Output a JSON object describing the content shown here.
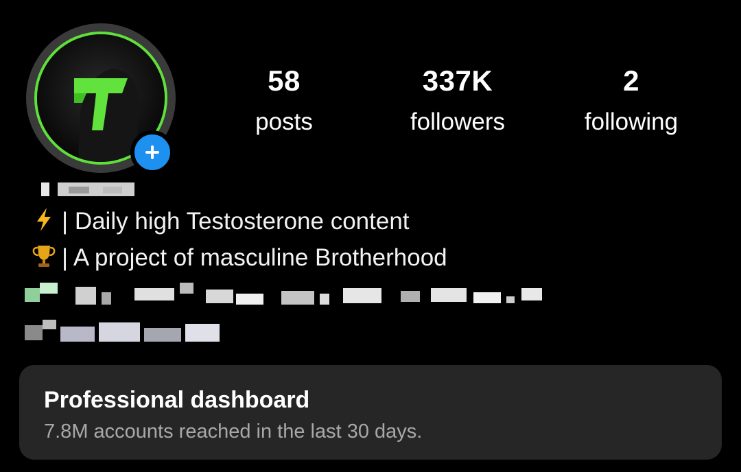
{
  "profile": {
    "avatar_icon": "brand-logo-icon",
    "ring_color": "#5fe03a",
    "add_story_icon": "plus-icon",
    "add_story_color": "#1e90f0"
  },
  "stats": {
    "posts": {
      "value": "58",
      "label": "posts"
    },
    "followers": {
      "value": "337K",
      "label": "followers"
    },
    "following": {
      "value": "2",
      "label": "following"
    }
  },
  "bio": {
    "line1": {
      "icon": "lightning-icon",
      "text": "| Daily high Testosterone content"
    },
    "line2": {
      "icon": "trophy-icon",
      "text": "| A project of masculine Brotherhood"
    }
  },
  "dashboard": {
    "title": "Professional dashboard",
    "subtitle": "7.8M accounts reached in the last 30 days."
  }
}
